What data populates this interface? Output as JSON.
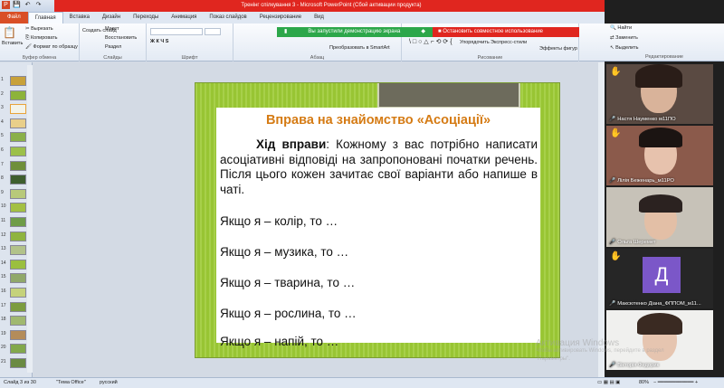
{
  "window": {
    "title": "Тренінг спілкування 3 - Microsoft PowerPoint (Сбой активации продукта)"
  },
  "ribbon_tabs": [
    {
      "label": "Файл"
    },
    {
      "label": "Главная"
    },
    {
      "label": "Вставка"
    },
    {
      "label": "Дизайн"
    },
    {
      "label": "Переходы"
    },
    {
      "label": "Анимация"
    },
    {
      "label": "Показ слайдов"
    },
    {
      "label": "Рецензирование"
    },
    {
      "label": "Вид"
    }
  ],
  "ribbon": {
    "paste": "Вставить",
    "cut": "Вырезать",
    "copy": "Копировать",
    "format_painter": "Формат по образцу",
    "clipboard_group": "Буфер обмена",
    "new_slide": "Создать слайд",
    "layout": "Макет",
    "reset": "Восстановить",
    "section": "Раздел",
    "slides_group": "Слайды",
    "font_group": "Шрифт",
    "paragraph_group": "Абзац",
    "smartart": "Преобразовать в SmartArt",
    "arrange": "Упорядочить",
    "quick_styles": "Экспресс-стили",
    "shape_effects": "Эффекты фигур",
    "drawing_group": "Рисование",
    "find": "Найти",
    "replace": "Заменить",
    "select": "Выделить",
    "editing_group": "Редактирование"
  },
  "share_bar": {
    "running": "Вы запустили демонстрацию экрана",
    "stop": "Остановить совместное использование"
  },
  "slide_numbers": [
    "1",
    "2",
    "3",
    "4",
    "5",
    "6",
    "7",
    "8",
    "9",
    "10",
    "11",
    "12",
    "13",
    "14",
    "15",
    "16",
    "17",
    "18",
    "19",
    "20",
    "21"
  ],
  "slide": {
    "title": "Вправа на знайомство «Асоціації»",
    "lead_bold": "Хід вправи",
    "lead_text": ": Кожному з вас потрібно написати асоціативні відповіді на запропоновані початки речень. Після цього кожен зачитає свої варіанти або напише в чаті.",
    "lines": [
      "Якщо я – колір, то …",
      "Якщо я – музика, то …",
      "Якщо я – тварина, то …",
      "Якщо я  – рослина, то …",
      "Якщо я – напій, то …"
    ]
  },
  "participants": [
    {
      "name": "Настя Науменко м11ПО",
      "hand": true
    },
    {
      "name": "Лілія Беженарь_м11РО",
      "hand": true
    },
    {
      "name": "Ольга Шеремет",
      "hand": false
    },
    {
      "name": "Максютенко Діана_ФППОМ_м11...",
      "hand": true,
      "initial": "Д"
    },
    {
      "name": "Вікторія Федорик",
      "hand": false
    }
  ],
  "watermark": {
    "line1": "Активация Windows",
    "line2": "Чтобы активировать Windows, перейдите в раздел",
    "line3": "\"Параметры\"."
  },
  "status": {
    "slide": "Слайд 3 из 30",
    "theme": "\"Тема Office\"",
    "lang": "русский",
    "zoom": "80%"
  }
}
